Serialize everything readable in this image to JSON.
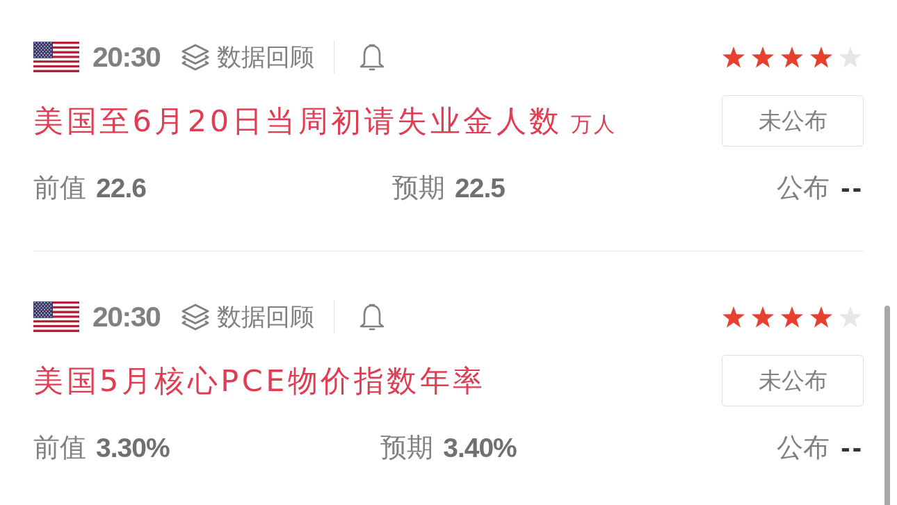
{
  "events": [
    {
      "time": "20:30",
      "review_link": "数据回顾",
      "stars": 4,
      "title": "美国至6月20日当周初请失业金人数",
      "unit": "万人",
      "status": "未公布",
      "figures": [
        {
          "label": "前值",
          "value": "22.6"
        },
        {
          "label": "预期",
          "value": "22.5"
        },
        {
          "label": "公布",
          "value": "--"
        }
      ]
    },
    {
      "time": "20:30",
      "review_link": "数据回顾",
      "stars": 4,
      "title": "美国5月核心PCE物价指数年率",
      "status": "未公布",
      "figures": [
        {
          "label": "前值",
          "value": "3.30%"
        },
        {
          "label": "预期",
          "value": "3.40%"
        },
        {
          "label": "公布",
          "value": "--"
        }
      ]
    }
  ]
}
